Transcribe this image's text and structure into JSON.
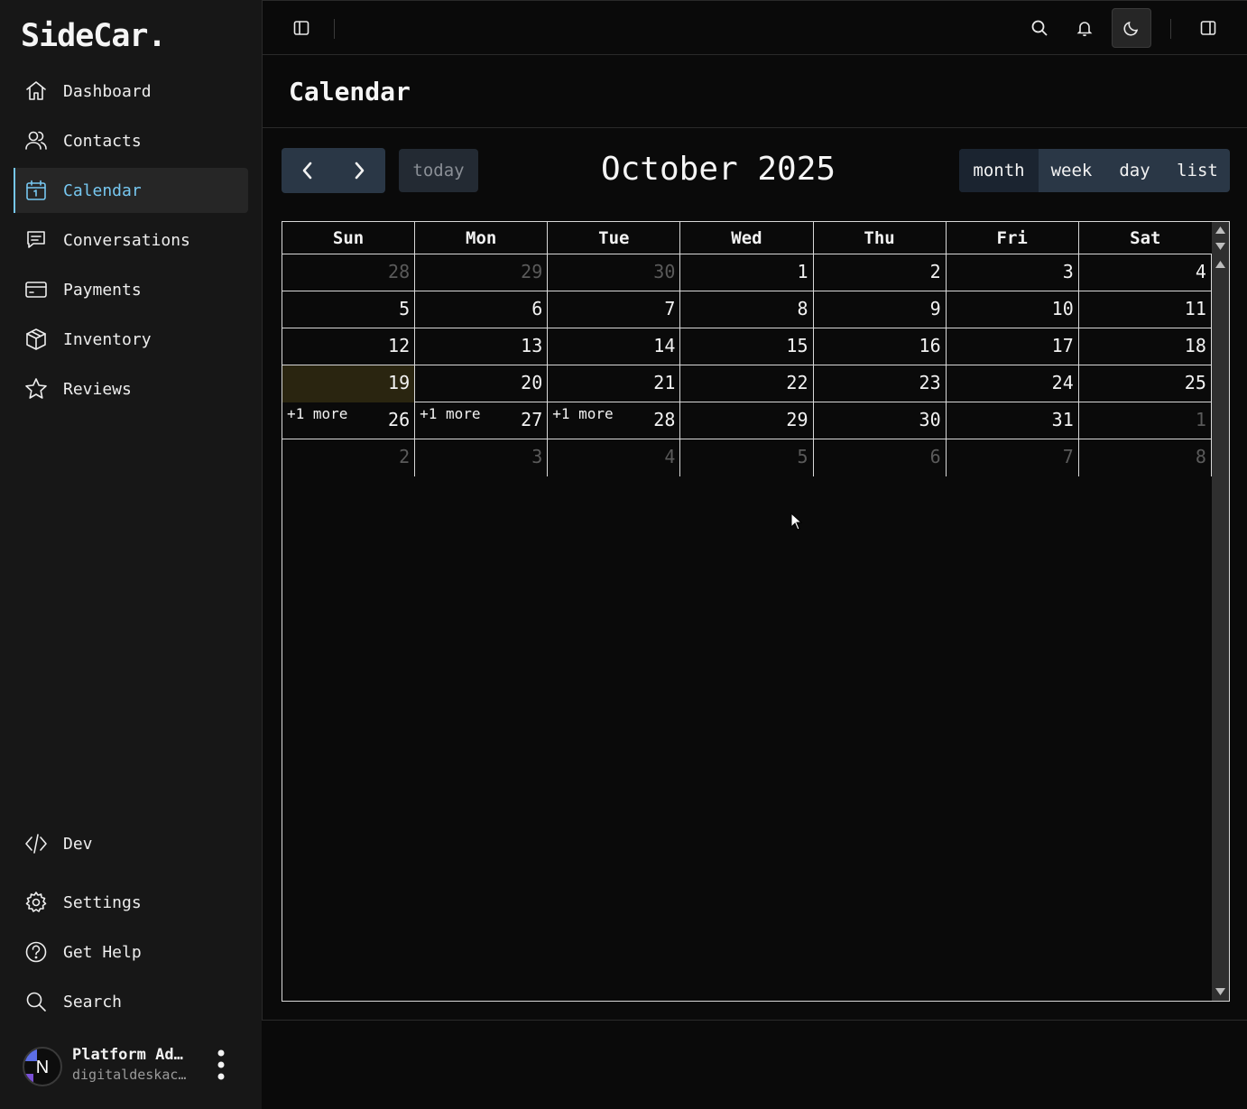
{
  "sidebar": {
    "brand": "SideCar.",
    "nav": [
      {
        "label": "Dashboard",
        "icon": "home-icon",
        "active": false
      },
      {
        "label": "Contacts",
        "icon": "users-icon",
        "active": false
      },
      {
        "label": "Calendar",
        "icon": "calendar-icon",
        "active": true
      },
      {
        "label": "Conversations",
        "icon": "message-icon",
        "active": false
      },
      {
        "label": "Payments",
        "icon": "credit-card-icon",
        "active": false
      },
      {
        "label": "Inventory",
        "icon": "box-icon",
        "active": false
      },
      {
        "label": "Reviews",
        "icon": "star-icon",
        "active": false
      }
    ],
    "bottom_nav": [
      {
        "label": "Dev",
        "icon": "code-icon"
      },
      {
        "label": "Settings",
        "icon": "gear-icon"
      },
      {
        "label": "Get Help",
        "icon": "help-icon"
      },
      {
        "label": "Search",
        "icon": "search-icon"
      }
    ],
    "user": {
      "avatar_letter": "N",
      "name": "Platform Ad…",
      "email": "digitaldeskac…"
    }
  },
  "header": {
    "title": "Calendar"
  },
  "calendar": {
    "title": "October 2025",
    "today_label": "today",
    "views": [
      {
        "label": "month",
        "active": true
      },
      {
        "label": "week",
        "active": false
      },
      {
        "label": "day",
        "active": false
      },
      {
        "label": "list",
        "active": false
      }
    ],
    "weekdays": [
      "Sun",
      "Mon",
      "Tue",
      "Wed",
      "Thu",
      "Fri",
      "Sat"
    ],
    "weeks": [
      [
        {
          "d": "28",
          "o": true
        },
        {
          "d": "29",
          "o": true
        },
        {
          "d": "30",
          "o": true
        },
        {
          "d": "1"
        },
        {
          "d": "2"
        },
        {
          "d": "3"
        },
        {
          "d": "4"
        }
      ],
      [
        {
          "d": "5"
        },
        {
          "d": "6"
        },
        {
          "d": "7"
        },
        {
          "d": "8"
        },
        {
          "d": "9"
        },
        {
          "d": "10"
        },
        {
          "d": "11"
        }
      ],
      [
        {
          "d": "12"
        },
        {
          "d": "13"
        },
        {
          "d": "14"
        },
        {
          "d": "15"
        },
        {
          "d": "16"
        },
        {
          "d": "17"
        },
        {
          "d": "18"
        }
      ],
      [
        {
          "d": "19",
          "today": true
        },
        {
          "d": "20"
        },
        {
          "d": "21"
        },
        {
          "d": "22"
        },
        {
          "d": "23"
        },
        {
          "d": "24"
        },
        {
          "d": "25"
        }
      ],
      [
        {
          "d": "26",
          "more": "+1 more"
        },
        {
          "d": "27",
          "more": "+1 more"
        },
        {
          "d": "28",
          "more": "+1 more"
        },
        {
          "d": "29"
        },
        {
          "d": "30"
        },
        {
          "d": "31"
        },
        {
          "d": "1",
          "o": true
        }
      ],
      [
        {
          "d": "2",
          "o": true
        },
        {
          "d": "3",
          "o": true
        },
        {
          "d": "4",
          "o": true
        },
        {
          "d": "5",
          "o": true
        },
        {
          "d": "6",
          "o": true
        },
        {
          "d": "7",
          "o": true
        },
        {
          "d": "8",
          "o": true
        }
      ]
    ]
  },
  "colors": {
    "accent": "#76c7f0",
    "today_bg": "#2a2510",
    "button_bg": "#2a3746"
  }
}
